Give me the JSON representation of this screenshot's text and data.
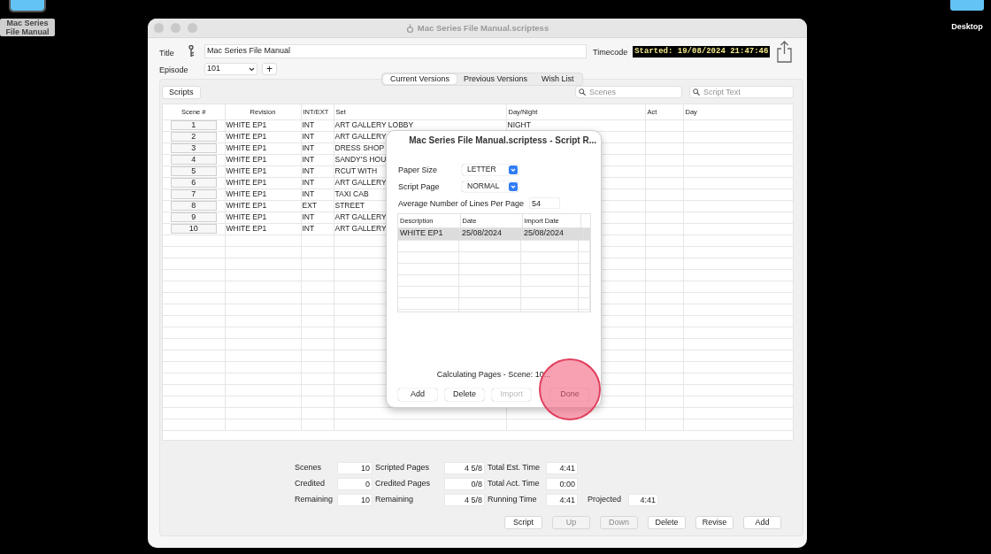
{
  "desktop_icons": [
    {
      "label": "Mac Series File Manual",
      "selected": true
    },
    {
      "label": "Desktop",
      "selected": false
    }
  ],
  "window": {
    "title": "Mac Series File Manual.scriptess"
  },
  "header": {
    "title_label": "Title",
    "title_value": "Mac Series File Manual",
    "timecode_label": "Timecode",
    "timecode": "Started: 19/08/2024 21:47:46",
    "episode_label": "Episode",
    "episode": "101",
    "add_episode": "+"
  },
  "tabs": [
    {
      "label": "Current Versions",
      "selected": true
    },
    {
      "label": "Previous Versions",
      "selected": false
    },
    {
      "label": "Wish List",
      "selected": false
    }
  ],
  "scripts_button": "Scripts",
  "search_fields": [
    {
      "placeholder": "Scenes"
    },
    {
      "placeholder": "Script Text"
    }
  ],
  "table": {
    "columns": [
      "Scene #",
      "Revision",
      "INT/EXT",
      "Set",
      "Day/Night",
      "Act",
      "Day"
    ],
    "rows": [
      {
        "scene": "1",
        "revision": "WHITE EP1",
        "int_ext": "INT",
        "set": "ART GALLERY LOBBY",
        "day_night": "NIGHT"
      },
      {
        "scene": "2",
        "revision": "WHITE EP1",
        "int_ext": "INT",
        "set": "ART GALLERY"
      },
      {
        "scene": "3",
        "revision": "WHITE EP1",
        "int_ext": "INT",
        "set": "DRESS SHOP"
      },
      {
        "scene": "4",
        "revision": "WHITE EP1",
        "int_ext": "INT",
        "set": "SANDY'S HOU"
      },
      {
        "scene": "5",
        "revision": "WHITE EP1",
        "int_ext": "INT",
        "set": "RCUT WITH"
      },
      {
        "scene": "6",
        "revision": "WHITE EP1",
        "int_ext": "INT",
        "set": "ART GALLERY"
      },
      {
        "scene": "7",
        "revision": "WHITE EP1",
        "int_ext": "INT",
        "set": "TAXI CAB"
      },
      {
        "scene": "8",
        "revision": "WHITE EP1",
        "int_ext": "EXT",
        "set": "STREET"
      },
      {
        "scene": "9",
        "revision": "WHITE EP1",
        "int_ext": "INT",
        "set": "ART GALLERY"
      },
      {
        "scene": "10",
        "revision": "WHITE EP1",
        "int_ext": "INT",
        "set": "ART GALLERY"
      }
    ]
  },
  "stats": [
    [
      {
        "label": "Scenes",
        "value": "10"
      },
      {
        "label": "Scripted Pages",
        "value": "4 5/8"
      },
      {
        "label": "Total Est. Time",
        "value": "4:41"
      }
    ],
    [
      {
        "label": "Credited",
        "value": "0"
      },
      {
        "label": "Credited Pages",
        "value": "0/8"
      },
      {
        "label": "Total Act. Time",
        "value": "0:00"
      }
    ],
    [
      {
        "label": "Remaining",
        "value": "10"
      },
      {
        "label": "Remaining",
        "value": "4 5/8"
      },
      {
        "label": "Running Time",
        "value": "4:41"
      },
      {
        "label": "Projected",
        "value": "4:41"
      }
    ]
  ],
  "buttons": [
    {
      "label": "Script",
      "disabled": false
    },
    {
      "label": "Up",
      "disabled": true
    },
    {
      "label": "Down",
      "disabled": true
    },
    {
      "label": "Delete",
      "disabled": false
    },
    {
      "label": "Revise",
      "disabled": false
    },
    {
      "label": "Add",
      "disabled": false
    }
  ],
  "dialog": {
    "title": "Mac Series File Manual.scriptess - Script R...",
    "fields": [
      {
        "kind": "select",
        "label": "Paper Size",
        "value": "LETTER"
      },
      {
        "kind": "select",
        "label": "Script Page",
        "value": "NORMAL"
      },
      {
        "kind": "text",
        "label": "Average Number of Lines Per Page",
        "value": "54"
      }
    ],
    "table": {
      "columns": [
        "Description",
        "Date",
        "Import Date"
      ],
      "rows": [
        {
          "cells": [
            "WHITE EP1",
            "25/08/2024",
            "25/08/2024"
          ],
          "selected": true
        }
      ]
    },
    "status": "Calculating Pages - Scene: 10...",
    "buttons": [
      {
        "label": "Add",
        "disabled": false
      },
      {
        "label": "Delete",
        "disabled": false
      },
      {
        "label": "Import",
        "disabled": true
      },
      {
        "label": "Done",
        "disabled": false
      }
    ]
  }
}
